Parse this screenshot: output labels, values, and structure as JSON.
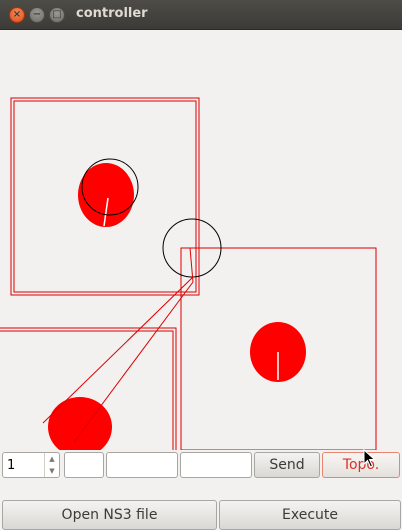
{
  "window": {
    "title": "controller",
    "close_glyph": "×",
    "minimize_glyph": "−",
    "maximize_glyph": "□"
  },
  "canvas": {
    "colors": {
      "node": "#ff0000",
      "range": "#000000",
      "link": "#dd0000",
      "boundary": "#dd0000"
    },
    "icons": [
      "node-disc",
      "range-circle"
    ]
  },
  "controls": {
    "spin_value": "1",
    "spin_up_glyph": "▲",
    "spin_down_glyph": "▼",
    "field_1": "",
    "field_2": "",
    "field_3": "",
    "send_label": "Send",
    "topo_label": "Topo."
  },
  "actions": {
    "open_label": "Open NS3 file",
    "execute_label": "Execute"
  }
}
